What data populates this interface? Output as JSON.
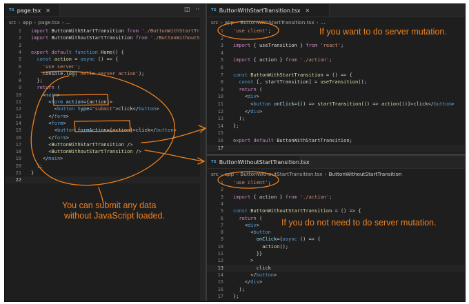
{
  "left_editor": {
    "tab": {
      "icon": "TS",
      "label": "page.tsx"
    },
    "breadcrumb": [
      "src",
      "app",
      "page.tsx",
      "..."
    ],
    "lines": [
      [
        [
          "kw",
          "import "
        ],
        [
          "txt",
          "ButtonWithStartTransition "
        ],
        [
          "kw",
          "from "
        ],
        [
          "str",
          "'./ButtonWithStartTransi"
        ]
      ],
      [
        [
          "kw",
          "import "
        ],
        [
          "txt",
          "ButtonWithoutStartTransition "
        ],
        [
          "kw",
          "from "
        ],
        [
          "str",
          "'./ButtonWithoutStart"
        ]
      ],
      [],
      [
        [
          "kw",
          "export default "
        ],
        [
          "kw2",
          "function "
        ],
        [
          "fn",
          "Home"
        ],
        [
          "txt",
          "() {"
        ]
      ],
      [
        [
          "txt",
          "  "
        ],
        [
          "kw2",
          "const "
        ],
        [
          "fn",
          "action"
        ],
        [
          "txt",
          " = "
        ],
        [
          "kw2",
          "async "
        ],
        [
          "txt",
          "() => {"
        ]
      ],
      [
        [
          "txt",
          "    "
        ],
        [
          "str",
          "'use server'"
        ],
        [
          "txt",
          ";"
        ]
      ],
      [
        [
          "txt",
          "    console."
        ],
        [
          "fn",
          "log"
        ],
        [
          "txt",
          "("
        ],
        [
          "str",
          "'hello server action'"
        ],
        [
          "txt",
          ");"
        ]
      ],
      [
        [
          "txt",
          "  };"
        ]
      ],
      [
        [
          "txt",
          "  "
        ],
        [
          "kw",
          "return "
        ],
        [
          "txt",
          "("
        ]
      ],
      [
        [
          "txt",
          "    <"
        ],
        [
          "tag",
          "main"
        ],
        [
          "txt",
          ">"
        ]
      ],
      [
        [
          "txt",
          "      <"
        ],
        [
          "tag",
          "form "
        ],
        [
          "attr",
          "action"
        ],
        [
          "txt",
          "={action}>"
        ]
      ],
      [
        [
          "txt",
          "        <"
        ],
        [
          "tag",
          "button "
        ],
        [
          "attr",
          "type"
        ],
        [
          "txt",
          "="
        ],
        [
          "str",
          "\"submit\""
        ],
        [
          "txt",
          ">click</"
        ],
        [
          "tag",
          "button"
        ],
        [
          "txt",
          ">"
        ]
      ],
      [
        [
          "txt",
          "      </"
        ],
        [
          "tag",
          "form"
        ],
        [
          "txt",
          ">"
        ]
      ],
      [
        [
          "txt",
          "      <"
        ],
        [
          "tag",
          "form"
        ],
        [
          "txt",
          ">"
        ]
      ],
      [
        [
          "txt",
          "        <"
        ],
        [
          "tag",
          "button "
        ],
        [
          "attr",
          "formAction"
        ],
        [
          "txt",
          "={action}>click</"
        ],
        [
          "tag",
          "button"
        ],
        [
          "txt",
          ">"
        ]
      ],
      [
        [
          "txt",
          "      </"
        ],
        [
          "tag",
          "form"
        ],
        [
          "txt",
          ">"
        ]
      ],
      [
        [
          "txt",
          "      <"
        ],
        [
          "fn",
          "ButtonWithStartTransition "
        ],
        [
          "txt",
          "/>"
        ]
      ],
      [
        [
          "txt",
          "      <"
        ],
        [
          "fn",
          "ButtonWithoutStartTransition "
        ],
        [
          "txt",
          "/>"
        ]
      ],
      [
        [
          "txt",
          "    </"
        ],
        [
          "tag",
          "main"
        ],
        [
          "txt",
          ">"
        ]
      ],
      [
        [
          "txt",
          "  );"
        ]
      ],
      [
        [
          "txt",
          "}"
        ]
      ],
      []
    ],
    "active_line": 22
  },
  "right_top_editor": {
    "tab": {
      "icon": "TS",
      "label": "ButtonWithStartTransition.tsx"
    },
    "breadcrumb": [
      "src",
      "app",
      "ButtonWithStartTransition.tsx",
      "..."
    ],
    "lines": [
      [
        [
          "str",
          "'use client'"
        ],
        [
          "txt",
          ";"
        ]
      ],
      [],
      [
        [
          "kw",
          "import "
        ],
        [
          "txt",
          "{ useTransition } "
        ],
        [
          "kw",
          "from "
        ],
        [
          "str",
          "'react'"
        ],
        [
          "txt",
          ";"
        ]
      ],
      [],
      [
        [
          "kw",
          "import "
        ],
        [
          "txt",
          "{ action } "
        ],
        [
          "kw",
          "from "
        ],
        [
          "str",
          "'./action'"
        ],
        [
          "txt",
          ";"
        ]
      ],
      [],
      [
        [
          "kw2",
          "const "
        ],
        [
          "fn",
          "ButtonWithStartTransition"
        ],
        [
          "txt",
          " = () => {"
        ]
      ],
      [
        [
          "txt",
          "  "
        ],
        [
          "kw2",
          "const "
        ],
        [
          "txt",
          "[, startTransition] = "
        ],
        [
          "fn",
          "useTransition"
        ],
        [
          "txt",
          "();"
        ]
      ],
      [
        [
          "txt",
          "  "
        ],
        [
          "kw",
          "return "
        ],
        [
          "txt",
          "("
        ]
      ],
      [
        [
          "txt",
          "    <"
        ],
        [
          "tag",
          "div"
        ],
        [
          "txt",
          ">"
        ]
      ],
      [
        [
          "txt",
          "      <"
        ],
        [
          "tag",
          "button "
        ],
        [
          "attr",
          "onClick"
        ],
        [
          "txt",
          "={() => "
        ],
        [
          "fn",
          "startTransition"
        ],
        [
          "txt",
          "(() => "
        ],
        [
          "fn",
          "action"
        ],
        [
          "txt",
          "())}>click</"
        ],
        [
          "tag",
          "button"
        ],
        [
          "txt",
          ">"
        ]
      ],
      [
        [
          "txt",
          "    </"
        ],
        [
          "tag",
          "div"
        ],
        [
          "txt",
          ">"
        ]
      ],
      [
        [
          "txt",
          "  );"
        ]
      ],
      [
        [
          "txt",
          "};"
        ]
      ],
      [],
      [
        [
          "kw",
          "export default "
        ],
        [
          "txt",
          "ButtonWithStartTransition;"
        ]
      ],
      []
    ],
    "active_line": 17
  },
  "right_bottom_editor": {
    "tab": {
      "icon": "TS",
      "label": "ButtonWithoutStartTransition.tsx"
    },
    "breadcrumb": [
      "src",
      "app",
      "ButtonWithoutStartTransition.tsx",
      "ButtonWithoutStartTransition"
    ],
    "lines": [
      [
        [
          "str",
          "'use client'"
        ],
        [
          "txt",
          ";"
        ]
      ],
      [],
      [
        [
          "kw",
          "import "
        ],
        [
          "txt",
          "{ action } "
        ],
        [
          "kw",
          "from "
        ],
        [
          "str",
          "'./action'"
        ],
        [
          "txt",
          ";"
        ]
      ],
      [],
      [
        [
          "kw2",
          "const "
        ],
        [
          "fn",
          "ButtonWithoutStartTransition"
        ],
        [
          "txt",
          " = () => {"
        ]
      ],
      [
        [
          "txt",
          "  "
        ],
        [
          "kw",
          "return "
        ],
        [
          "txt",
          "("
        ]
      ],
      [
        [
          "txt",
          "    <"
        ],
        [
          "tag",
          "div"
        ],
        [
          "txt",
          ">"
        ]
      ],
      [
        [
          "txt",
          "      <"
        ],
        [
          "tag",
          "button"
        ]
      ],
      [
        [
          "txt",
          "        "
        ],
        [
          "attr",
          "onClick"
        ],
        [
          "txt",
          "={"
        ],
        [
          "kw2",
          "async "
        ],
        [
          "txt",
          "() => {"
        ]
      ],
      [
        [
          "txt",
          "          "
        ],
        [
          "fn",
          "action"
        ],
        [
          "txt",
          "();"
        ]
      ],
      [
        [
          "txt",
          "        }}"
        ]
      ],
      [
        [
          "txt",
          "      >"
        ]
      ],
      [
        [
          "txt",
          "        click"
        ]
      ],
      [
        [
          "txt",
          "      </"
        ],
        [
          "tag",
          "button"
        ],
        [
          "txt",
          ">"
        ]
      ],
      [
        [
          "txt",
          "    </"
        ],
        [
          "tag",
          "div"
        ],
        [
          "txt",
          ">"
        ]
      ],
      [
        [
          "txt",
          "  );"
        ]
      ],
      [
        [
          "txt",
          "};"
        ]
      ],
      []
    ],
    "active_line": 13
  },
  "annotations": {
    "server_mutation": "If you want to do server mutation.",
    "no_server_mutation": "If you do not need to do server mutation.",
    "submit_line1": "You can submit any data",
    "submit_line2": "without JavaScript loaded."
  },
  "colors": {
    "accent": "#f0821e",
    "editor_bg": "#1e1e1e"
  }
}
